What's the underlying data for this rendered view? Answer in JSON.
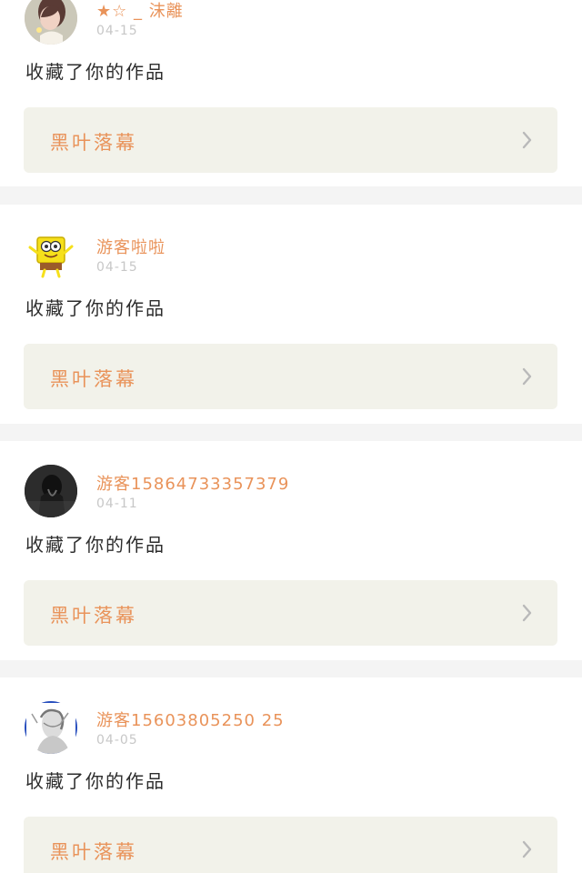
{
  "colors": {
    "name_color": "#e9935a",
    "date_color": "#c7c7c7",
    "text_color": "#2d2d2d",
    "link_bg": "#f2f2ea",
    "divider_bg": "#f4f4f4"
  },
  "icons": {
    "chevron": "chevron-right-icon"
  },
  "feed": {
    "items": [
      {
        "user_name": "★☆ _ 沫離",
        "date": "04-15",
        "action": "收藏了你的作品",
        "work_title": "黑叶落幕",
        "avatar_icon": "girl-photo-avatar-icon"
      },
      {
        "user_name": "游客啦啦",
        "date": "04-15",
        "action": "收藏了你的作品",
        "work_title": "黑叶落幕",
        "avatar_icon": "cartoon-sponge-avatar-icon"
      },
      {
        "user_name": "游客15864733357379",
        "date": "04-11",
        "action": "收藏了你的作品",
        "work_title": "黑叶落幕",
        "avatar_icon": "dark-figure-avatar-icon"
      },
      {
        "user_name": "游客15603805250 25",
        "date": "04-05",
        "action": "收藏了你的作品",
        "work_title": "黑叶落幕",
        "avatar_icon": "sketch-portrait-avatar-icon"
      }
    ]
  }
}
